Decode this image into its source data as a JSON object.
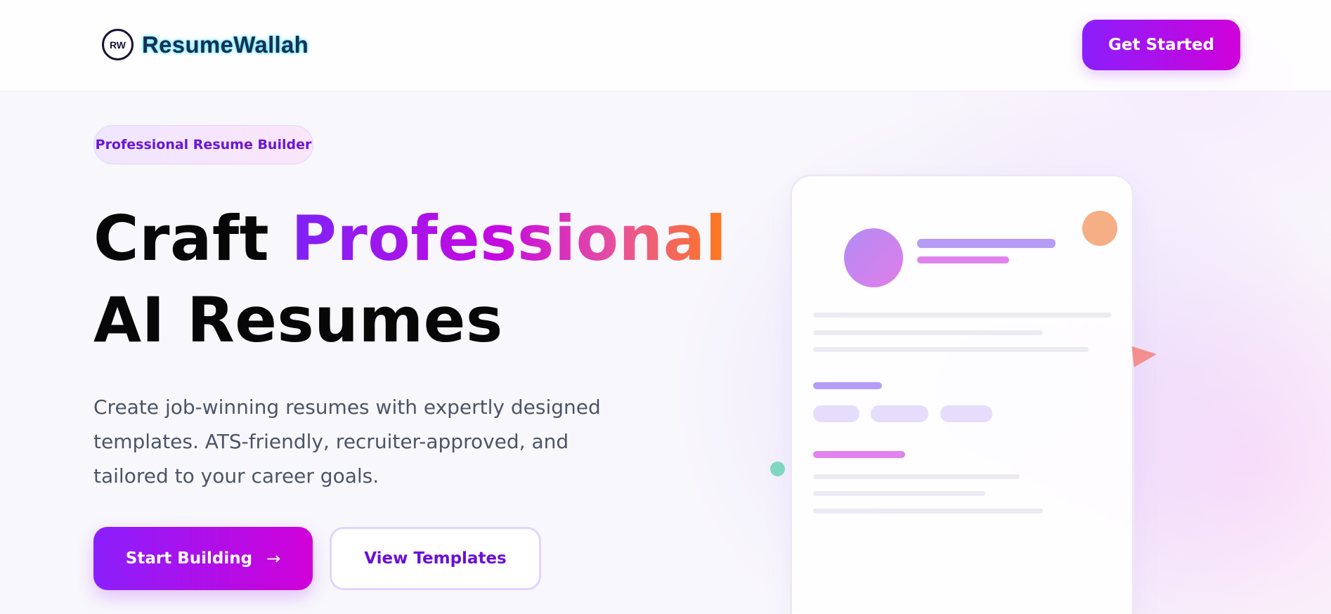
{
  "header": {
    "logo_badge": "RW",
    "brand_name": "ResumeWallah",
    "cta_label": "Get Started"
  },
  "hero": {
    "badge_label": "Professional Resume Builder",
    "headline_part1": "Craft ",
    "headline_accent": "Professional",
    "headline_line2": "AI Resumes",
    "subtext": "Create job-winning resumes with expertly designed templates. ATS-friendly, recruiter-approved, and tailored to your career goals.",
    "primary_button": "Start Building",
    "primary_button_icon": "→",
    "secondary_button": "View Templates"
  },
  "colors": {
    "brand_gradient_start": "#8a1ffc",
    "brand_gradient_end": "#d000d8",
    "accent_orange": "#ff7a1a",
    "secondary_text": "#4b5567"
  }
}
